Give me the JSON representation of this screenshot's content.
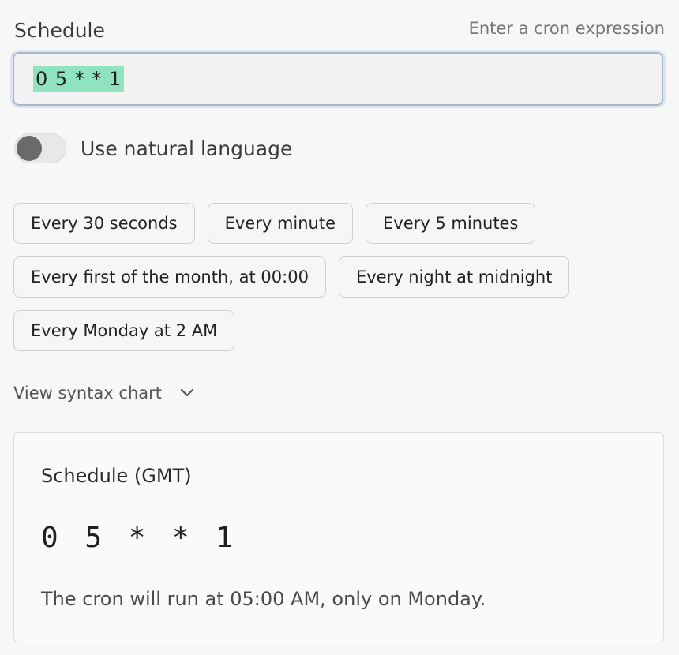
{
  "schedule": {
    "label": "Schedule",
    "hint": "Enter a cron expression",
    "value": "0 5 * * 1"
  },
  "natural_language": {
    "label": "Use natural language",
    "enabled": false
  },
  "presets": [
    [
      "Every 30 seconds",
      "Every minute",
      "Every 5 minutes"
    ],
    [
      "Every first of the month, at 00:00",
      "Every night at midnight"
    ],
    [
      "Every Monday at 2 AM"
    ]
  ],
  "syntax": {
    "label": "View syntax chart"
  },
  "summary": {
    "title": "Schedule (GMT)",
    "cron": "0 5 * * 1",
    "description": "The cron will run at 05:00 AM, only on Monday."
  }
}
